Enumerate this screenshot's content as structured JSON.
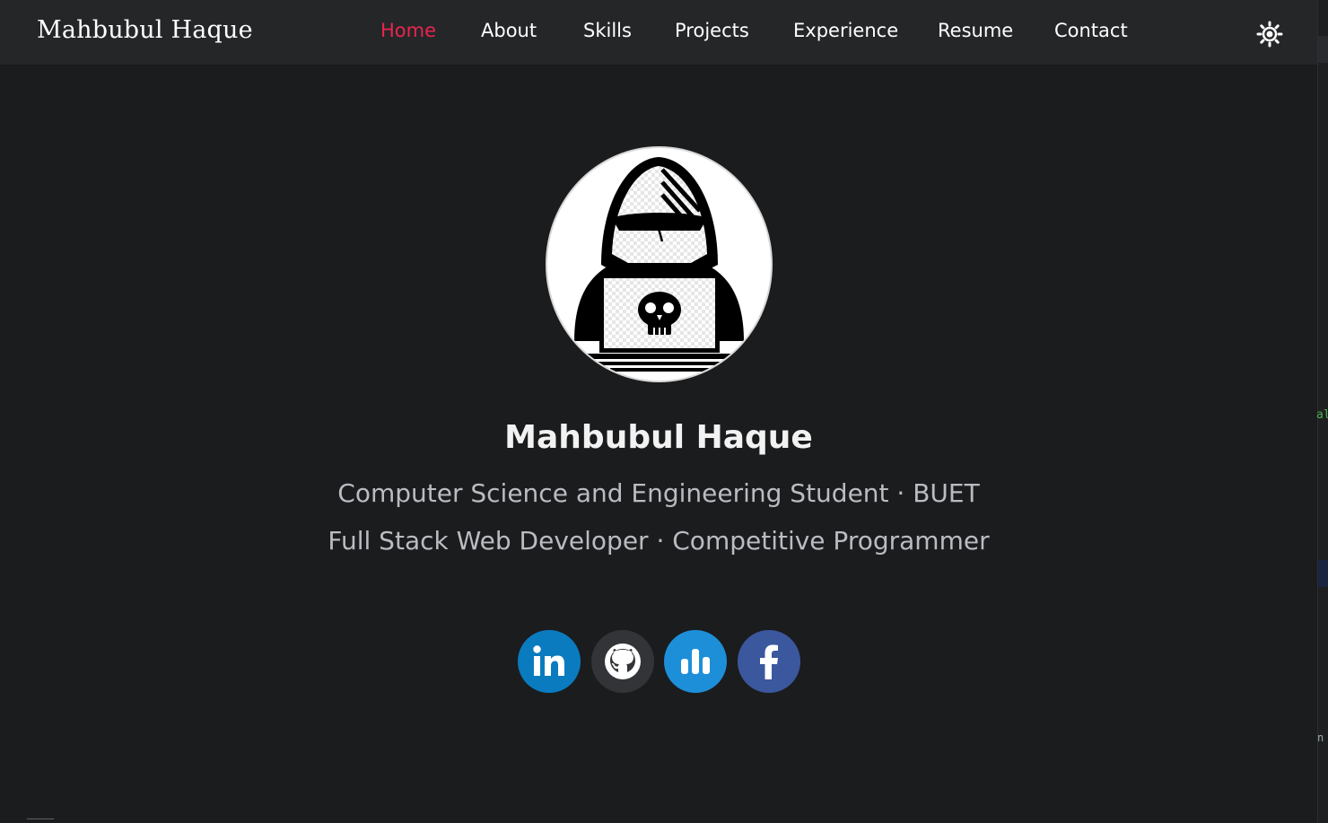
{
  "navbar": {
    "brand": "Mahbubul Haque",
    "links": [
      {
        "label": "Home",
        "active": true
      },
      {
        "label": "About",
        "active": false
      },
      {
        "label": "Skills",
        "active": false
      },
      {
        "label": "Projects",
        "active": false
      },
      {
        "label": "Experience",
        "active": false
      },
      {
        "label": "Resume",
        "active": false
      },
      {
        "label": "Contact",
        "active": false
      }
    ],
    "theme_toggle_icon": "sun-icon"
  },
  "hero": {
    "avatar_icon": "hacker-with-laptop-icon",
    "name": "Mahbubul Haque",
    "subtitle_1": "Computer Science and Engineering Student · BUET",
    "subtitle_2": "Full Stack Web Developer · Competitive Programmer"
  },
  "socials": [
    {
      "name": "linkedin",
      "icon": "linkedin-icon",
      "color": "#0a7bbf"
    },
    {
      "name": "github",
      "icon": "github-icon",
      "color": "#333437"
    },
    {
      "name": "stats",
      "icon": "bar-chart-icon",
      "color": "#1d8fd9"
    },
    {
      "name": "facebook",
      "icon": "facebook-icon",
      "color": "#3b579d"
    }
  ],
  "colors": {
    "background": "#1b1c1e",
    "navbar": "#252628",
    "accent": "#e8244f"
  }
}
